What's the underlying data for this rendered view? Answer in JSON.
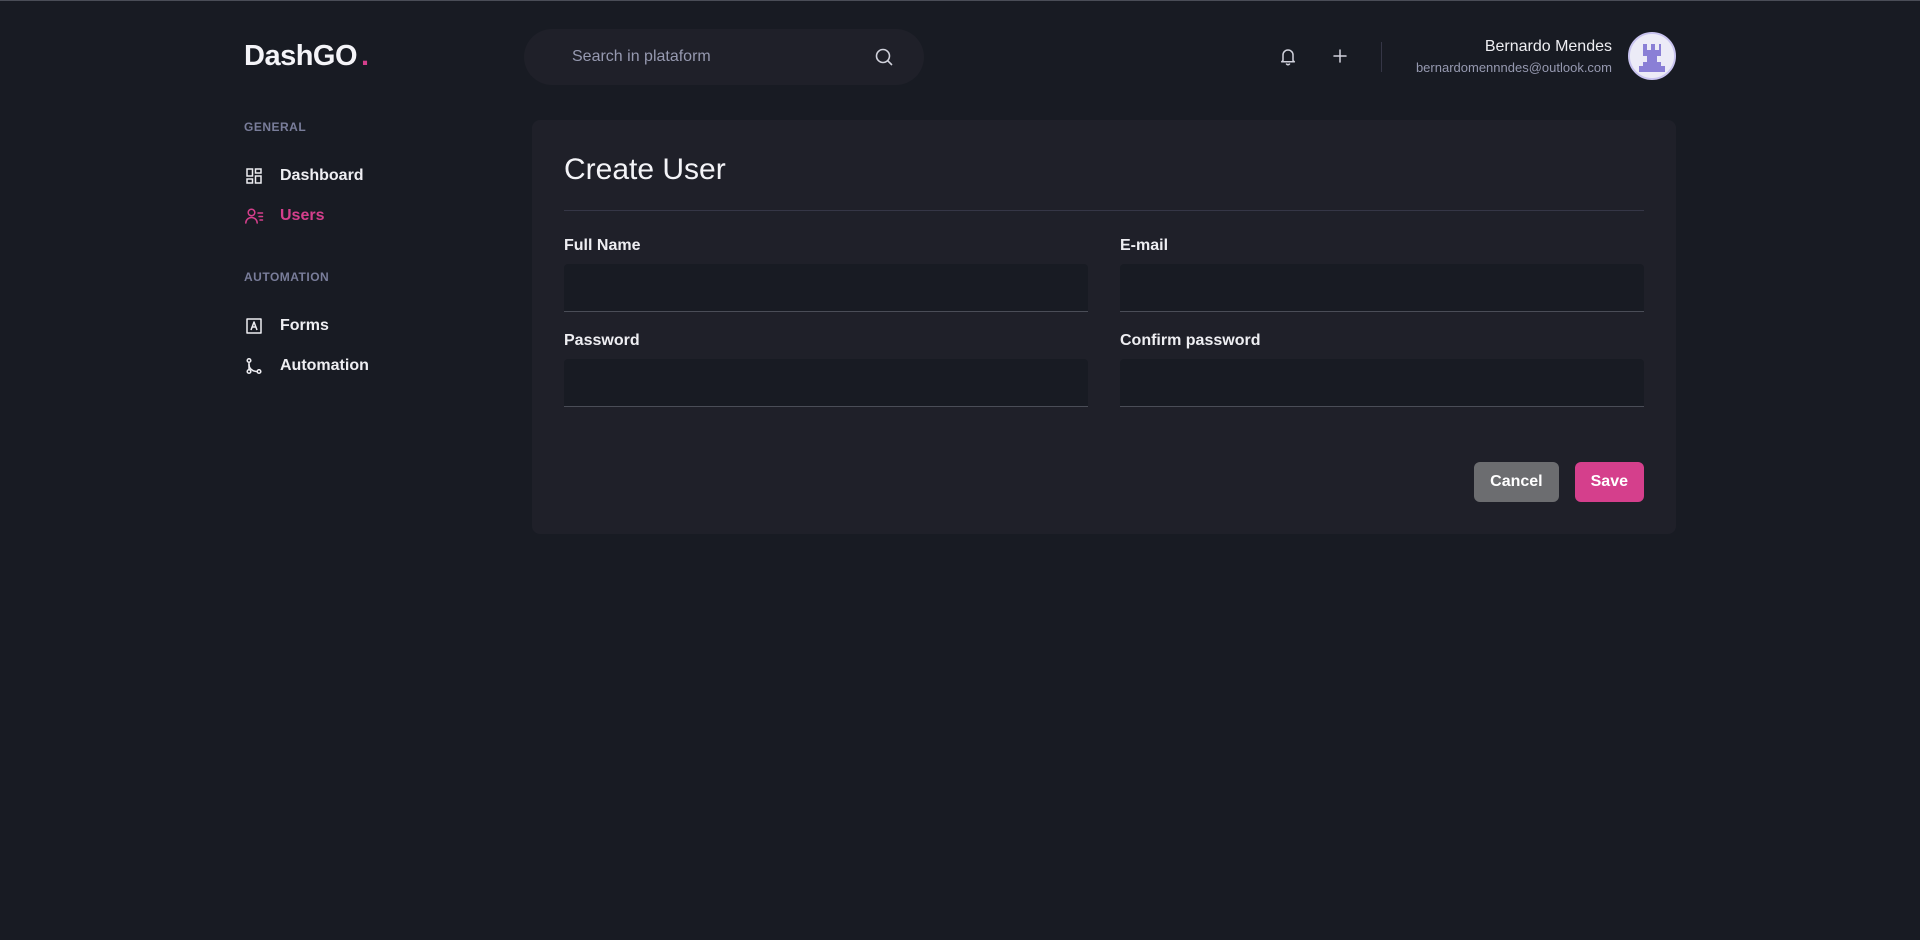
{
  "header": {
    "logo_text": "DashGO",
    "logo_dot": ".",
    "search_placeholder": "Search in plataform",
    "user_name": "Bernardo Mendes",
    "user_email": "bernardomennndes@outlook.com"
  },
  "sidebar": {
    "sections": [
      {
        "title": "GENERAL",
        "items": [
          {
            "label": "Dashboard",
            "icon": "dashboard-icon",
            "active": false
          },
          {
            "label": "Users",
            "icon": "users-icon",
            "active": true
          }
        ]
      },
      {
        "title": "AUTOMATION",
        "items": [
          {
            "label": "Forms",
            "icon": "forms-icon",
            "active": false
          },
          {
            "label": "Automation",
            "icon": "automation-icon",
            "active": false
          }
        ]
      }
    ]
  },
  "form": {
    "title": "Create User",
    "fields": {
      "full_name_label": "Full Name",
      "email_label": "E-mail",
      "password_label": "Password",
      "confirm_password_label": "Confirm password"
    },
    "cancel_label": "Cancel",
    "save_label": "Save"
  },
  "colors": {
    "background": "#181B23",
    "card": "#1F2029",
    "accent": "#D53F8C",
    "cancel": "#6C6D70",
    "muted": "#9699B0"
  }
}
